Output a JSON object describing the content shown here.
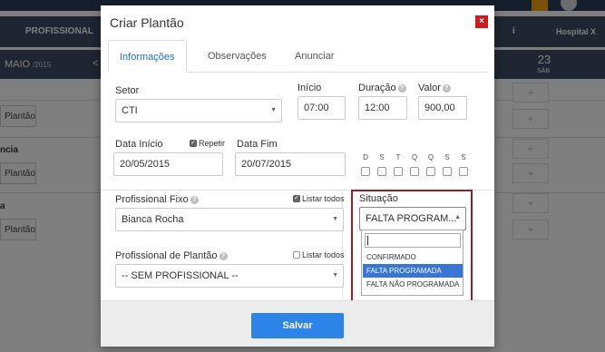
{
  "background": {
    "nav_tab": "PROFISSIONAL",
    "info_icon": "i",
    "hospital": "Hospital X",
    "month": "MAIO",
    "year": "/2015",
    "prev_icon": "<",
    "day_number": "23",
    "day_name": "SÁB",
    "rows": [
      {
        "label": "",
        "button": "Plantão"
      },
      {
        "label": "ncia",
        "button": "Plantão"
      },
      {
        "label": "a",
        "button": "Plantão"
      }
    ],
    "add_symbol": "+"
  },
  "modal": {
    "title": "Criar Plantão",
    "close_symbol": "×",
    "tabs": [
      {
        "label": "Informações",
        "active": true
      },
      {
        "label": "Observações",
        "active": false
      },
      {
        "label": "Anunciar",
        "active": false
      }
    ],
    "setor": {
      "label": "Setor",
      "value": "CTI"
    },
    "inicio": {
      "label": "Início",
      "value": "07:00"
    },
    "duracao": {
      "label": "Duração",
      "value": "12:00"
    },
    "valor": {
      "label": "Valor",
      "value": "900,00"
    },
    "data_inicio": {
      "label": "Data Início",
      "value": "20/05/2015"
    },
    "repetir": {
      "label": "Repetir",
      "checked": true
    },
    "data_fim": {
      "label": "Data Fim",
      "value": "20/07/2015"
    },
    "week_days": [
      "D",
      "S",
      "T",
      "Q",
      "Q",
      "S",
      "S"
    ],
    "profissional_fixo": {
      "label": "Profissional Fixo",
      "value": "Bianca Rocha"
    },
    "listar_todos_1": {
      "label": "Listar todos",
      "checked": true
    },
    "profissional_plantao": {
      "label": "Profissional de Plantão",
      "value": "-- SEM PROFISSIONAL --"
    },
    "listar_todos_2": {
      "label": "Listar todos",
      "checked": false
    },
    "situacao": {
      "label": "Situação",
      "value": "FALTA PROGRAM...",
      "options": [
        "CONFIRMADO",
        "FALTA PROGRAMADA",
        "FALTA NÃO PROGRAMADA"
      ],
      "selected_index": 1
    },
    "help_symbol": "?",
    "caret_symbol": "▼",
    "save_label": "Salvar"
  },
  "colors": {
    "accent": "#2c83e8",
    "tab_active": "#1a6fc4",
    "close": "#d0191d",
    "highlight": "#9b1c22",
    "option_selected": "#3875d7"
  }
}
